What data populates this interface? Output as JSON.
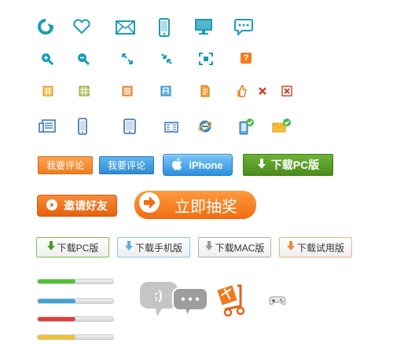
{
  "colors": {
    "icon_teal": "#1b9bb9",
    "orange": "#f07a1e",
    "blue": "#2f8bd2",
    "green": "#4a8c1c"
  },
  "icons": {
    "row1": [
      "refresh-icon",
      "heart-icon",
      "mail-icon",
      "mobile-icon",
      "monitor-icon",
      "chat-bubble-icon"
    ],
    "row2": [
      "zoom-in-icon",
      "zoom-out-icon",
      "expand-icon",
      "collapse-icon",
      "fit-screen-icon",
      "help-icon"
    ],
    "row3": [
      "calendar-icon",
      "grid-icon",
      "menu-icon",
      "list-icon",
      "document-icon",
      "thumbs-up-icon",
      "close-icon",
      "close-box-icon"
    ],
    "row4": [
      "newspaper-icon",
      "phone-icon",
      "tablet-icon",
      "book-icon",
      "ie-browser-icon",
      "phone-check-icon",
      "mail-check-icon"
    ]
  },
  "help_glyph": "?",
  "smiley_glyph": ";)",
  "buttons": {
    "comment_orange": "我要评论",
    "comment_blue": "我要评论",
    "iphone": "iPhone",
    "download_pc_big": "下载PC版",
    "invite": "邀请好友",
    "lottery": "立即抽奖",
    "download_pc": "下载PC版",
    "download_mobile": "下载手机版",
    "download_mac": "下载MAC版",
    "download_trial": "下载试用版"
  },
  "progress_bars": [
    {
      "color": "#52c234",
      "value": 0.5
    },
    {
      "color": "#3fa3dc",
      "value": 0.5
    },
    {
      "color": "#e23c3c",
      "value": 0.5
    },
    {
      "color": "#f5c02a",
      "value": 0.5
    }
  ]
}
